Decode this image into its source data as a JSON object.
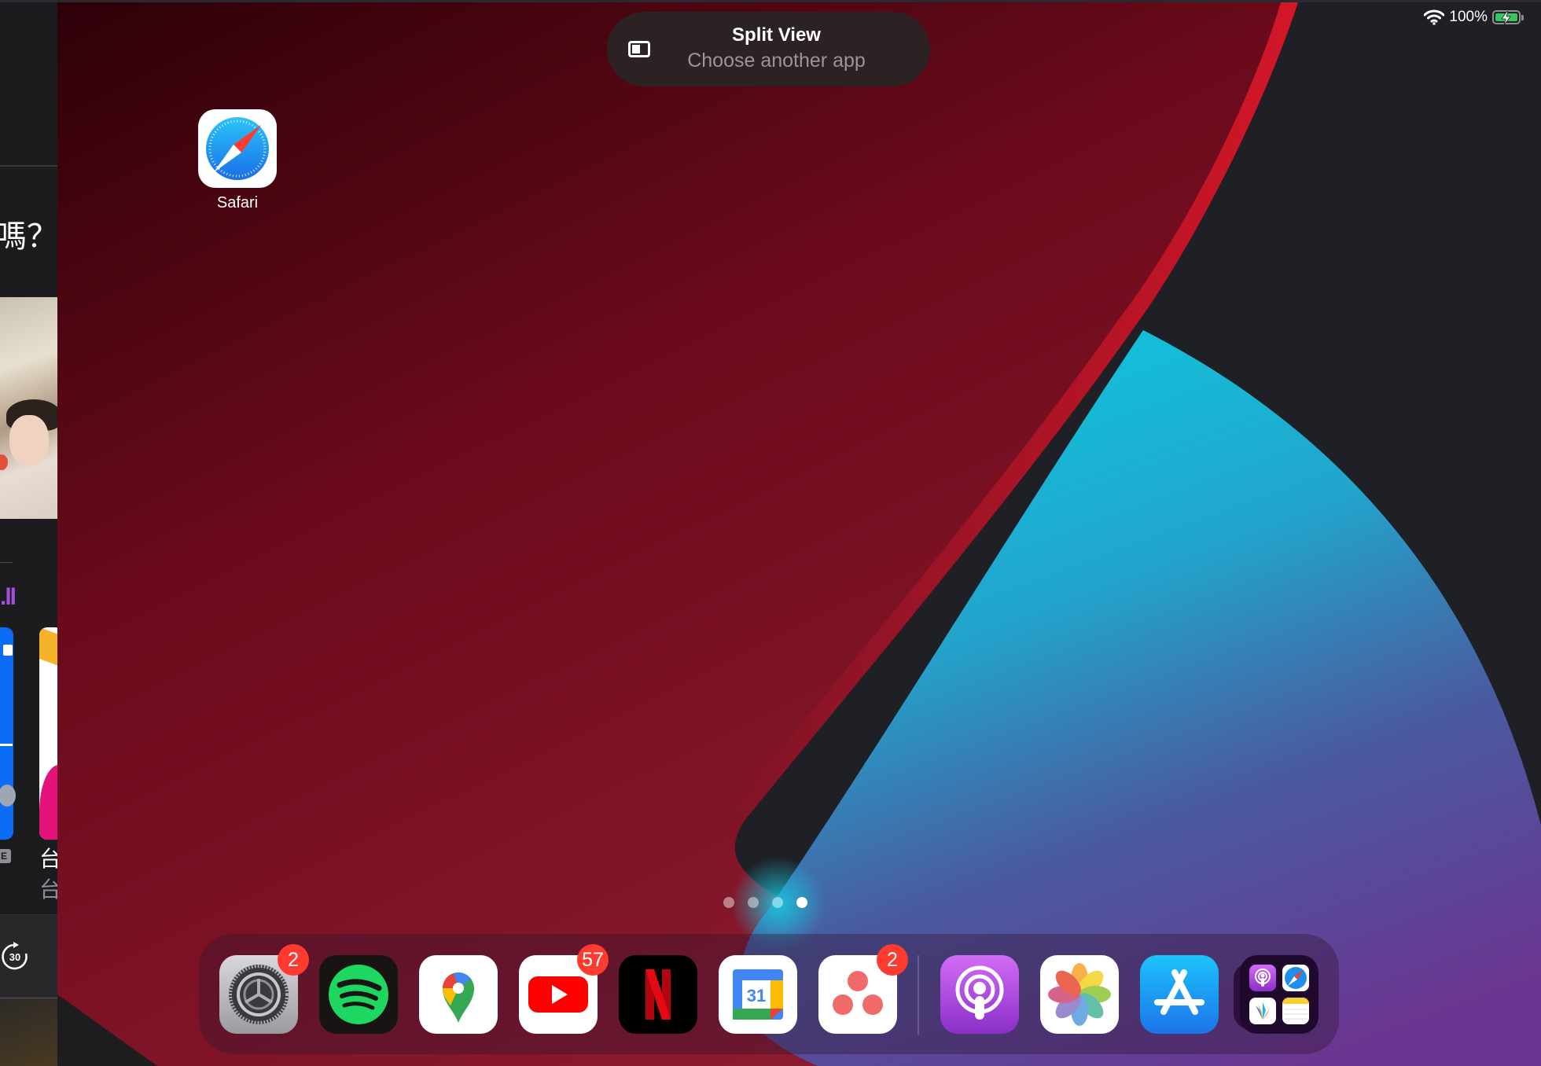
{
  "status_bar": {
    "wifi_icon": "wifi-icon",
    "battery_percent": "100%",
    "battery_icon": "battery-charging-icon",
    "battery_level": 1.0,
    "charging": true
  },
  "split_view": {
    "icon": "split-view-icon",
    "title": "Split View",
    "subtitle": "Choose another app"
  },
  "slide_over_panel": {
    "headline_fragment": "嗎？",
    "card_badge": "E",
    "item_title": "台",
    "item_subtitle": "台",
    "skip_icon_label": "30"
  },
  "home_screen": {
    "apps": [
      {
        "name": "Safari",
        "icon": "safari-icon"
      }
    ],
    "pages": {
      "count": 4,
      "current": 4
    }
  },
  "dock": {
    "apps": [
      {
        "name": "Settings",
        "icon": "settings-icon",
        "badge": "2"
      },
      {
        "name": "Spotify",
        "icon": "spotify-icon",
        "badge": ""
      },
      {
        "name": "Google Maps",
        "icon": "google-maps-icon",
        "badge": ""
      },
      {
        "name": "YouTube",
        "icon": "youtube-icon",
        "badge": "57"
      },
      {
        "name": "Netflix",
        "icon": "netflix-icon",
        "badge": ""
      },
      {
        "name": "Google Calendar",
        "icon": "google-calendar-icon",
        "badge": "",
        "date": "31"
      },
      {
        "name": "Asana",
        "icon": "asana-icon",
        "badge": "2"
      }
    ],
    "recent_apps": [
      {
        "name": "Podcasts",
        "icon": "podcasts-icon"
      },
      {
        "name": "Photos",
        "icon": "photos-icon"
      },
      {
        "name": "App Store",
        "icon": "app-store-icon"
      }
    ],
    "app_library": {
      "name": "App Library",
      "icon": "app-library-icon",
      "apps": [
        "Podcasts",
        "Safari",
        "Artstudio",
        "Notes"
      ]
    }
  },
  "colors": {
    "badge": "#ff3b30",
    "battery": "#34c759",
    "wallpaper_red": "#8a1020",
    "wallpaper_cyan": "#12c0d8",
    "wallpaper_purple": "#5a3a8e",
    "wallpaper_dark": "#1f2026"
  }
}
